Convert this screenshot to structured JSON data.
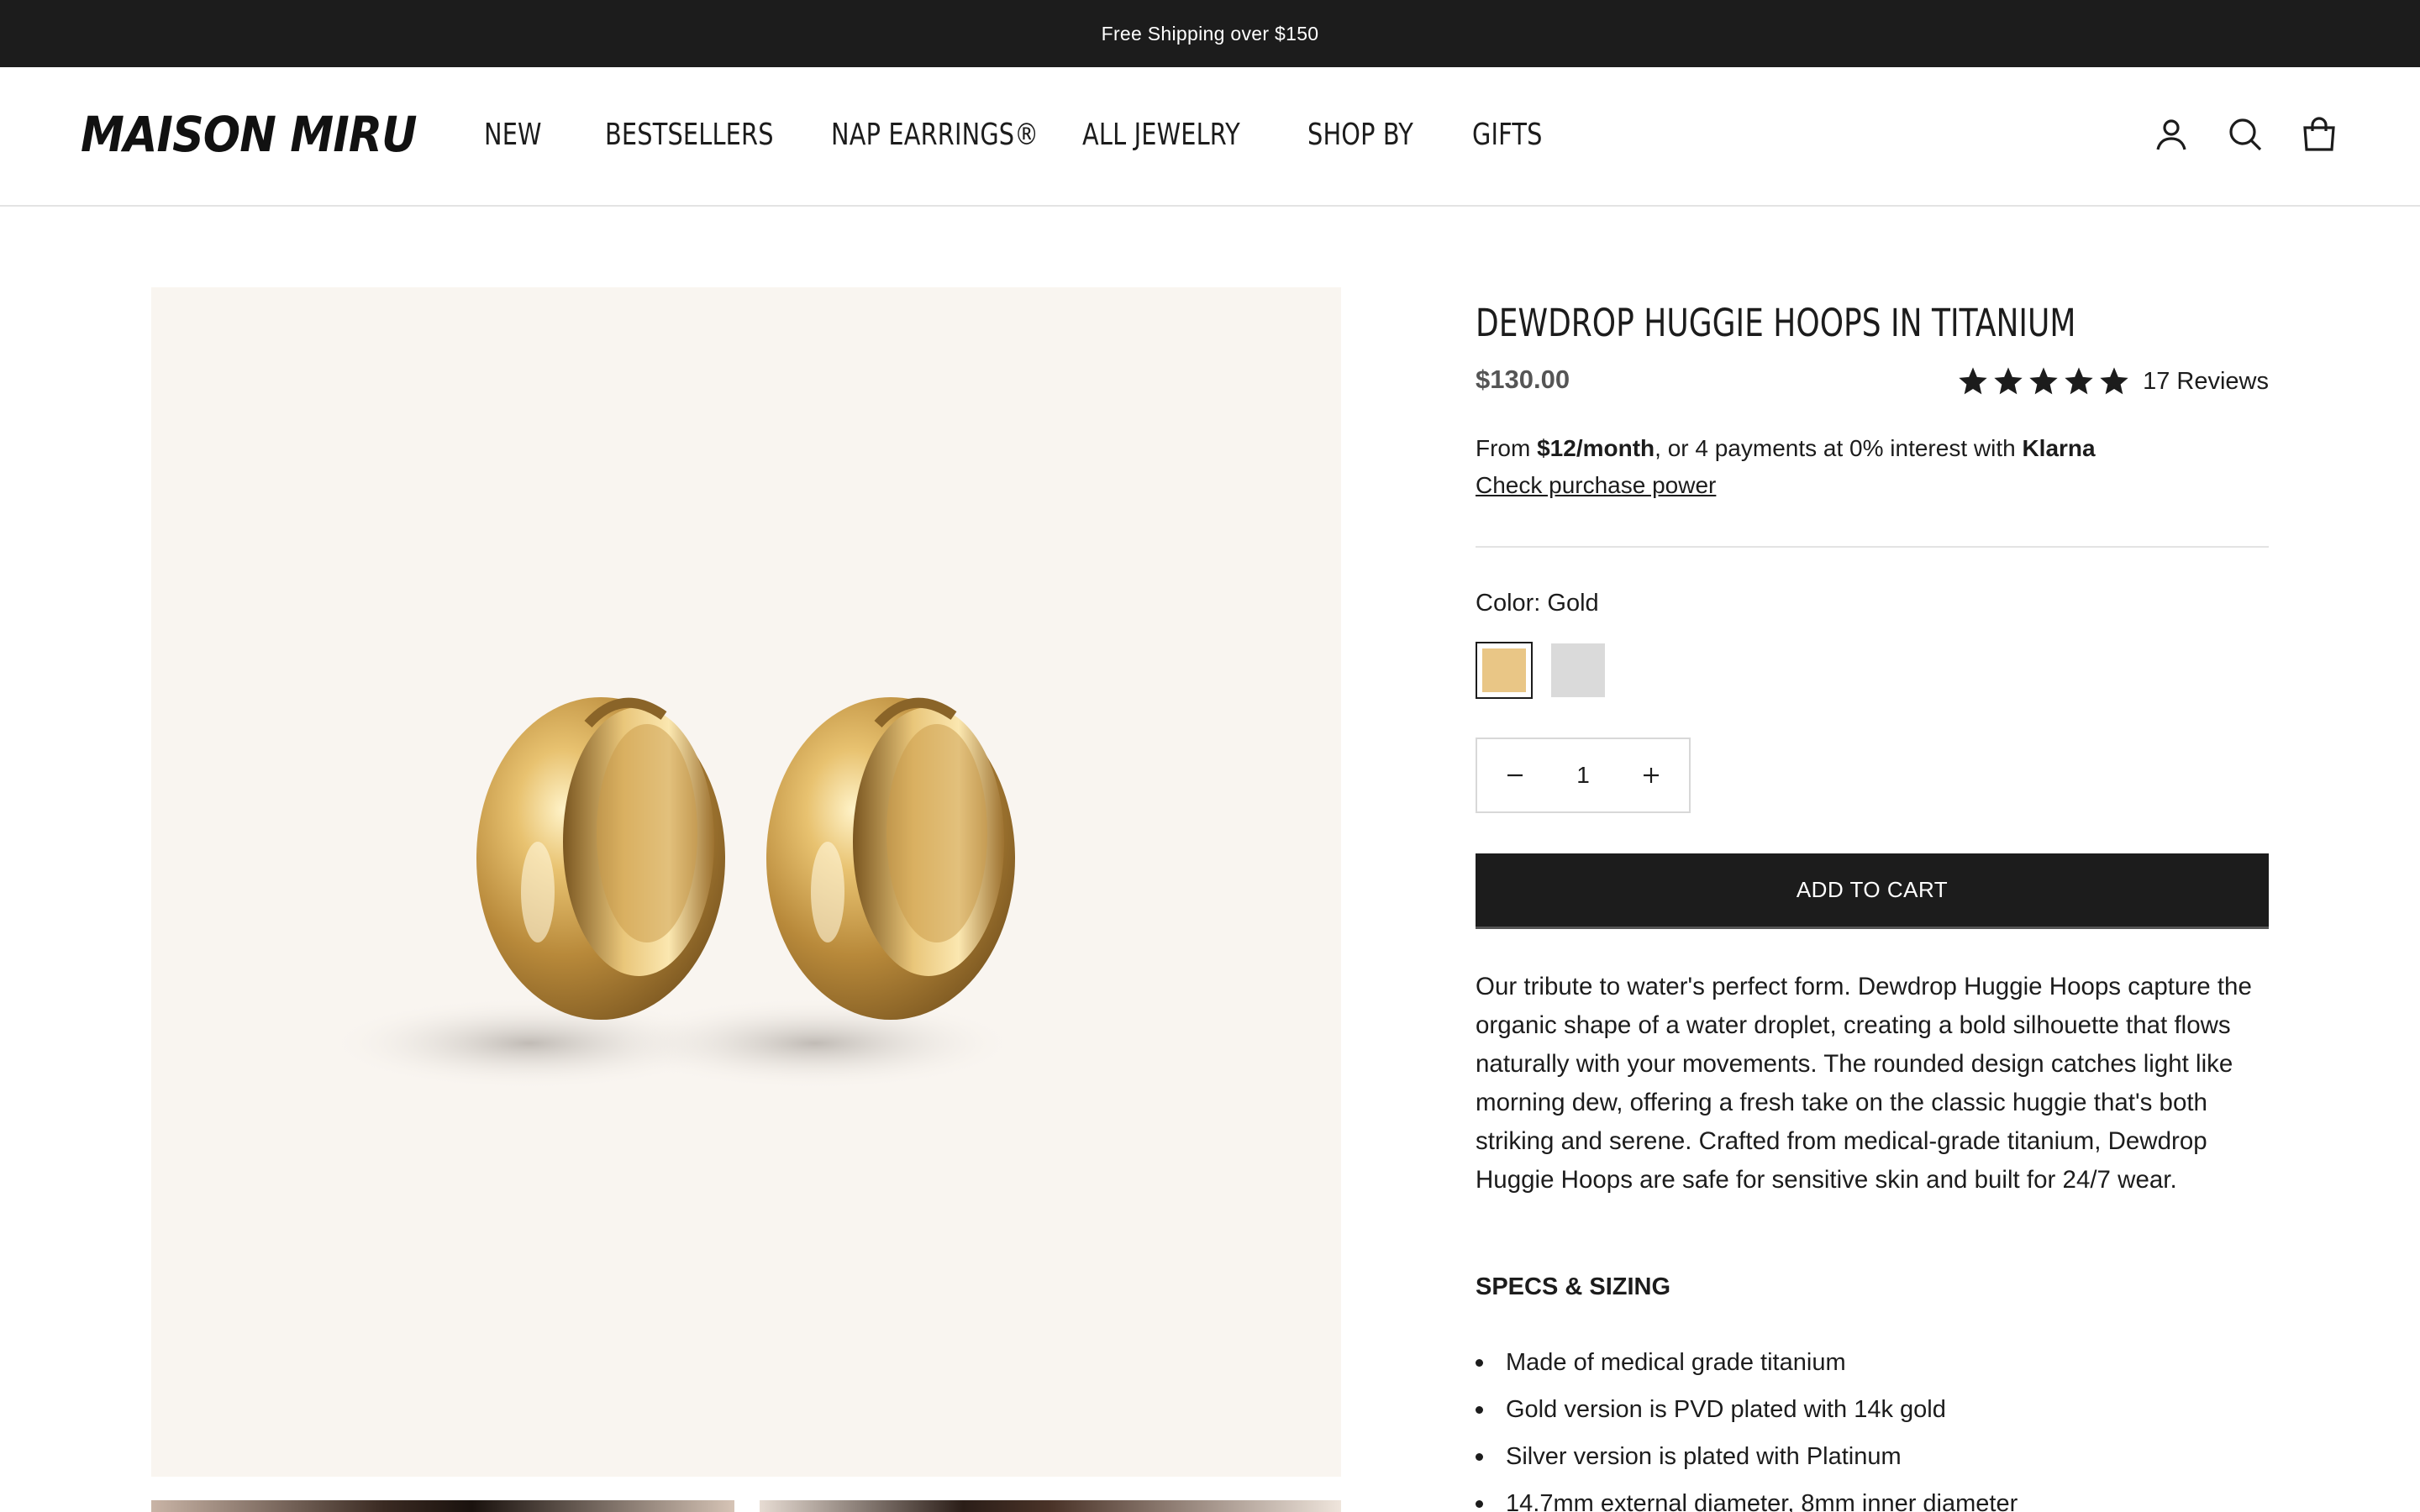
{
  "announcement": {
    "text": "Free Shipping over $150"
  },
  "header": {
    "logo": "MAISON MIRU",
    "nav": [
      {
        "label": "NEW"
      },
      {
        "label": "BESTSELLERS"
      },
      {
        "label": "NAP EARRINGS®"
      },
      {
        "label": "ALL JEWELRY"
      },
      {
        "label": "SHOP BY"
      },
      {
        "label": "GIFTS"
      }
    ],
    "icons": [
      "account-icon",
      "search-icon",
      "bag-icon"
    ]
  },
  "product": {
    "title": "DEWDROP HUGGIE HOOPS IN TITANIUM",
    "price": "$130.00",
    "rating": {
      "stars": 5,
      "reviews_label": "17 Reviews"
    },
    "klarna": {
      "from": "From ",
      "monthly": "$12/month",
      "middle": ", or 4 payments at 0% interest with ",
      "brand": "Klarna",
      "link": "Check purchase power"
    },
    "color": {
      "label": "Color: Gold",
      "swatches": [
        {
          "name": "Gold",
          "hex": "#e9c686",
          "selected": true
        },
        {
          "name": "Silver",
          "hex": "#dadada",
          "selected": false
        }
      ]
    },
    "quantity": {
      "value": "1"
    },
    "add_to_cart": "ADD TO CART",
    "description": "Our tribute to water's perfect form. Dewdrop Huggie Hoops capture the organic shape of a water droplet, creating a bold silhouette that flows naturally with your movements. The rounded design catches light like morning dew, offering a fresh take on the classic huggie that's both striking and serene. Crafted from medical-grade titanium, Dewdrop Huggie Hoops are safe for sensitive skin and built for 24/7 wear.",
    "specs_heading": "SPECS & SIZING",
    "specs": [
      "Made of medical grade titanium",
      "Gold version is PVD plated with 14k gold",
      "Silver version is plated with Platinum",
      "14.7mm external diameter, 8mm inner diameter"
    ]
  },
  "colors": {
    "dark": "#1c1c1c",
    "image_bg": "#f9f5f0",
    "divider": "#e3e3e3"
  }
}
